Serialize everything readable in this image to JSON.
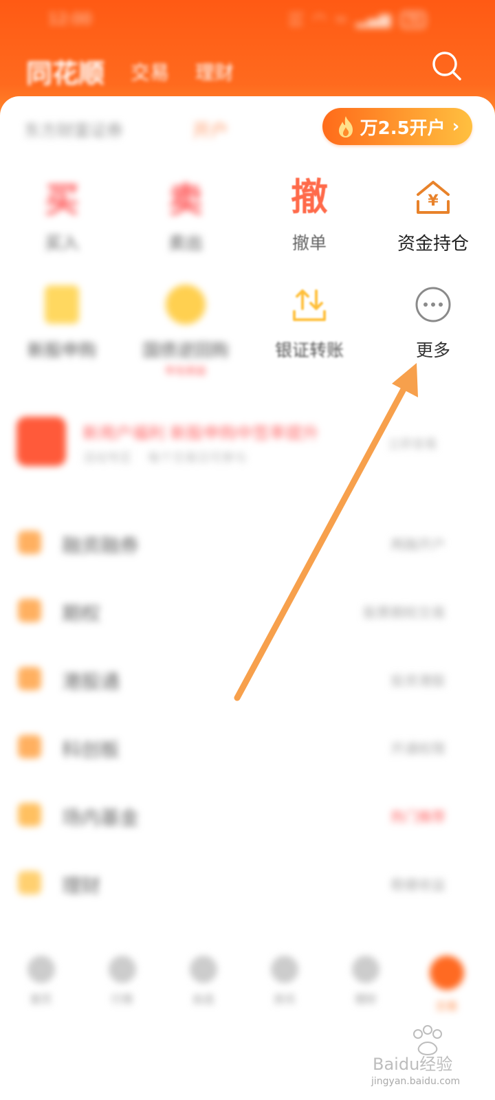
{
  "status_bar": {
    "time": "12:00",
    "net_top": "107",
    "net_bottom": "K/S",
    "signal": "5G",
    "battery": "70"
  },
  "header": {
    "brand": "同花顺",
    "tabs": [
      "交易",
      "理财"
    ]
  },
  "promo": {
    "left_text": "东方财富证券",
    "tag": "开户",
    "button_label": "万2.5开户"
  },
  "grid_row1": [
    {
      "label": "买入",
      "char": "买"
    },
    {
      "label": "卖出",
      "char": "卖"
    },
    {
      "label": "撤单",
      "char": "撤"
    },
    {
      "label": "资金持仓"
    }
  ],
  "grid_row2": [
    {
      "label": "新股申购"
    },
    {
      "label": "国债逆回购",
      "sub": "年化收益"
    },
    {
      "label": "银证转账"
    },
    {
      "label": "更多"
    }
  ],
  "news": {
    "title": "新用户福利 新股申购中签率提升",
    "meta_left": "活动专区",
    "meta_mid": "每个交易日可参与",
    "date": "立即查看"
  },
  "list": [
    {
      "label": "融资融券",
      "value": "两融开户"
    },
    {
      "label": "期权",
      "value": "股票期权交易"
    },
    {
      "label": "港股通",
      "value": "投资港股"
    },
    {
      "label": "科创板",
      "value": "开通权限"
    },
    {
      "label": "场内基金",
      "value": "热门推荐",
      "red": true
    },
    {
      "label": "理财",
      "value": "稳健收益"
    }
  ],
  "bottom_nav": [
    "首页",
    "行情",
    "自选",
    "资讯",
    "理财",
    "交易"
  ],
  "watermark": {
    "brand": "Baidu经验",
    "url": "jingyan.baidu.com"
  },
  "colors": {
    "brand": "#ff5a14",
    "accent_orange": "#e8822a",
    "arrow": "#f7a04c"
  }
}
